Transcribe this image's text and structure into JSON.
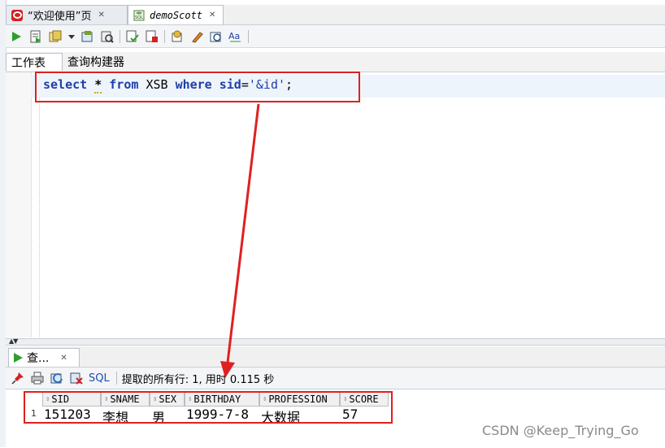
{
  "tabs": [
    {
      "label": "“欢迎使用”页",
      "active": false
    },
    {
      "label": "demoScott",
      "active": true
    }
  ],
  "sub_tabs": [
    "工作表",
    "查询构建器"
  ],
  "editor": {
    "sql": {
      "kw_select": "select",
      "star": "*",
      "kw_from": "from",
      "table": "XSB",
      "kw_where": "where",
      "column": "sid",
      "equals": "=",
      "value": "'&id'",
      "semicolon": ";"
    }
  },
  "results": {
    "tab_label": "查...",
    "sql_link": "SQL",
    "status_text": "提取的所有行: 1, 用时 0.115 秒",
    "columns": [
      "SID",
      "SNAME",
      "SEX",
      "BIRTHDAY",
      "PROFESSION",
      "SCORE"
    ],
    "rows": [
      {
        "num": "1",
        "cells": [
          "151203",
          "李想",
          "男",
          "1999-7-8",
          "大数据",
          "57"
        ]
      }
    ]
  },
  "watermark": "CSDN @Keep_Trying_Go",
  "colors": {
    "annotation_red": "#e02020",
    "keyword_blue": "#1e3fa8",
    "oracle_red": "#d62020"
  },
  "icons": [
    "run-statement-icon",
    "run-script-icon",
    "autotrace-icon",
    "dropdown-icon",
    "commit-icon",
    "rollback-icon",
    "explain-plan-icon",
    "sql-tuning-icon",
    "clear-icon",
    "history-icon",
    "format-icon",
    "pin-icon",
    "print-icon",
    "refresh-icon",
    "delete-icon"
  ]
}
